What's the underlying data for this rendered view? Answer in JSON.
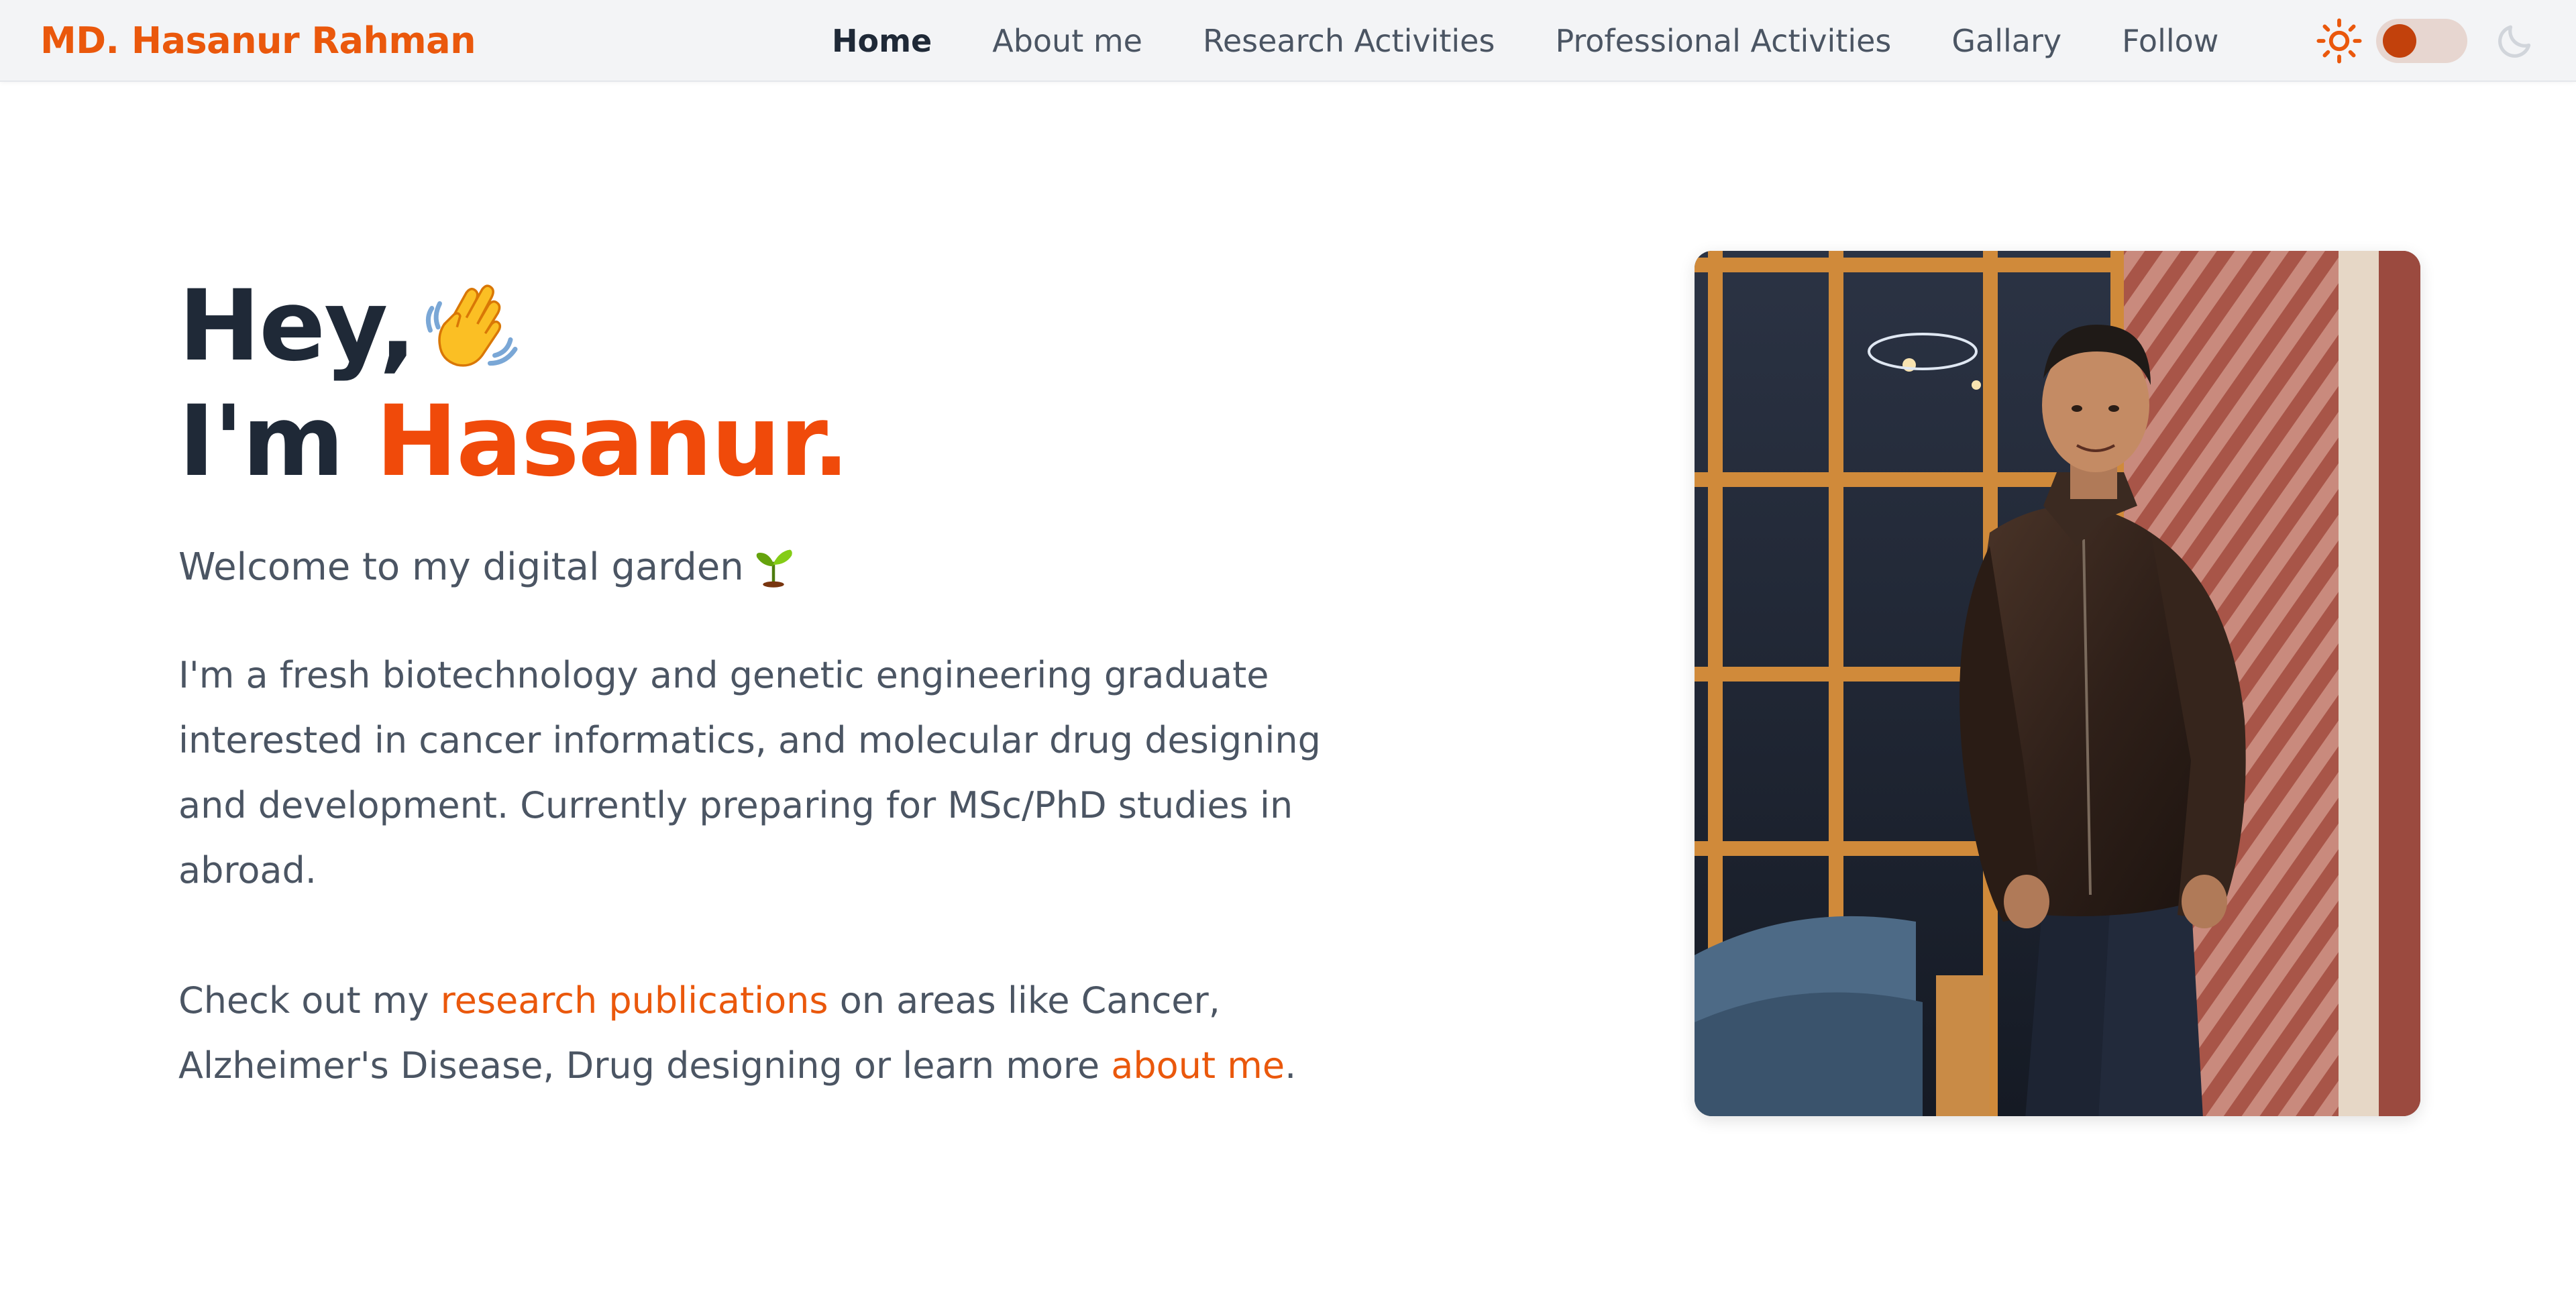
{
  "navbar": {
    "brand": "MD. Hasanur Rahman",
    "links": [
      {
        "label": "Home",
        "active": true
      },
      {
        "label": "About me",
        "active": false
      },
      {
        "label": "Research Activities",
        "active": false
      },
      {
        "label": "Professional Activities",
        "active": false
      },
      {
        "label": "Gallary",
        "active": false
      },
      {
        "label": "Follow",
        "active": false
      }
    ],
    "theme_toggle": {
      "left_icon": "sun-icon",
      "right_icon": "moon-icon",
      "state": "light"
    }
  },
  "hero": {
    "greeting": "Hey,",
    "greeting_icon": "waving-hand-icon",
    "intro_prefix": "I'm ",
    "name": "Hasanur.",
    "welcome": "Welcome to my digital garden",
    "welcome_icon": "seedling-icon",
    "bio_lines": [
      "I'm a fresh biotechnology and genetic engineering graduate",
      "interested in cancer informatics, and molecular drug designing",
      "and development. Currently preparing for MSc/PhD studies in",
      "abroad."
    ],
    "cta": {
      "line1_prefix": "Check out my ",
      "research_link": "research publications",
      "line1_suffix": " on areas like Cancer,",
      "line2_prefix": "Alzheimer's Disease, Drug designing or learn more ",
      "about_link": "about me",
      "line2_suffix": "."
    },
    "photo_icon": "profile-photo"
  },
  "colors": {
    "accent": "#ea580c",
    "name_accent": "#f04a0a",
    "heading": "#1f2937",
    "body_text": "#4b5563",
    "navbar_bg": "#f3f4f6"
  }
}
